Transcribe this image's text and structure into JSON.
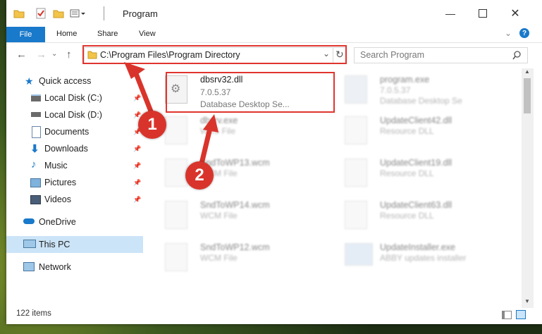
{
  "window": {
    "title": "Program"
  },
  "ribbon": {
    "file": "File",
    "tabs": [
      "Home",
      "Share",
      "View"
    ]
  },
  "nav": {
    "address": "C:\\Program Files\\Program Directory",
    "search_placeholder": "Search Program"
  },
  "sidebar": {
    "items": [
      {
        "label": "Quick access",
        "icon": "star-icon",
        "pinned": false
      },
      {
        "label": "Local Disk (C:)",
        "icon": "drive-icon",
        "pinned": true
      },
      {
        "label": "Local Disk (D:)",
        "icon": "drive-icon",
        "pinned": true
      },
      {
        "label": "Documents",
        "icon": "documents-icon",
        "pinned": true
      },
      {
        "label": "Downloads",
        "icon": "download-icon",
        "pinned": true
      },
      {
        "label": "Music",
        "icon": "music-icon",
        "pinned": true
      },
      {
        "label": "Pictures",
        "icon": "pictures-icon",
        "pinned": true
      },
      {
        "label": "Videos",
        "icon": "videos-icon",
        "pinned": true
      },
      {
        "label": "OneDrive",
        "icon": "cloud-icon",
        "pinned": false
      },
      {
        "label": "This PC",
        "icon": "computer-icon",
        "pinned": false,
        "selected": true
      },
      {
        "label": "Network",
        "icon": "network-icon",
        "pinned": false
      }
    ]
  },
  "files": {
    "highlighted": {
      "name": "dbsrv32.dll",
      "version": "7.0.5.37",
      "desc": "Database Desktop Se..."
    },
    "col1": [
      {
        "name": "dbsrv.exe",
        "type": "WBS File"
      },
      {
        "name": "SndToWP13.wcm",
        "type": "WCM File"
      },
      {
        "name": "SndToWP14.wcm",
        "type": "WCM File"
      },
      {
        "name": "SndToWP12.wcm",
        "type": "WCM File"
      }
    ],
    "col2": [
      {
        "name": "program.exe",
        "version": "7.0.5.37",
        "desc": "Database Desktop Se"
      },
      {
        "name": "UpdateClient42.dll",
        "type": "Resource DLL"
      },
      {
        "name": "UpdateClient19.dll",
        "type": "Resource DLL"
      },
      {
        "name": "UpdateClient63.dll",
        "type": "Resource DLL"
      },
      {
        "name": "UpdateInstaller.exe",
        "type": "ABBY updates installer"
      }
    ]
  },
  "status": {
    "items": "122 items"
  },
  "annotations": {
    "step1": "1",
    "step2": "2"
  },
  "colors": {
    "accent": "#1979ca",
    "highlight": "#e0352e",
    "badge": "#d9342b"
  }
}
